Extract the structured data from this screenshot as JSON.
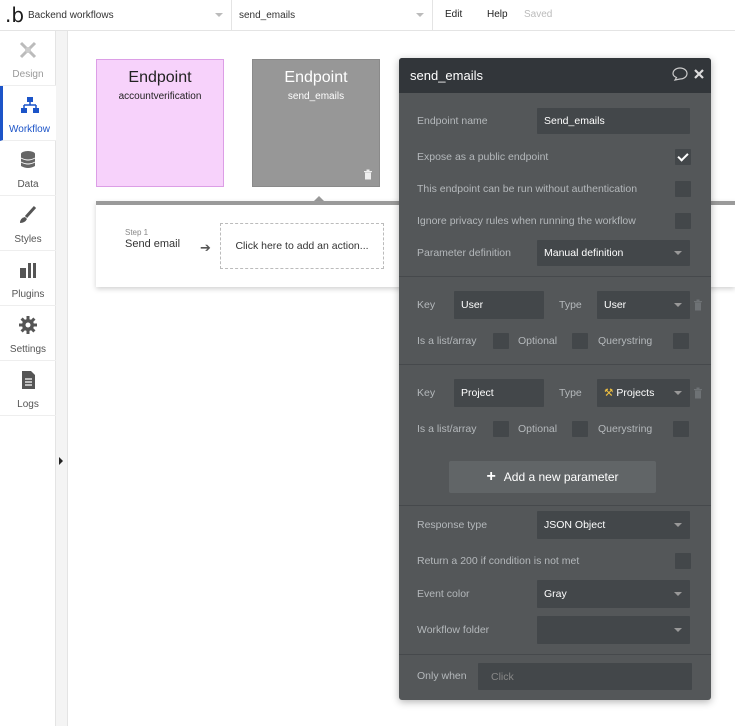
{
  "topbar": {
    "logo": ".b",
    "page_select": "Backend workflows",
    "workflow_select": "send_emails",
    "edit_label": "Edit",
    "help_label": "Help",
    "saved_label": "Saved"
  },
  "sidebar": {
    "items": [
      {
        "label": "Design",
        "icon": "design-icon"
      },
      {
        "label": "Workflow",
        "icon": "workflow-icon"
      },
      {
        "label": "Data",
        "icon": "database-icon"
      },
      {
        "label": "Styles",
        "icon": "brush-icon"
      },
      {
        "label": "Plugins",
        "icon": "plugins-icon"
      },
      {
        "label": "Settings",
        "icon": "gear-icon"
      },
      {
        "label": "Logs",
        "icon": "document-icon"
      }
    ],
    "active_accent": "#1c54c8"
  },
  "canvas": {
    "cards": [
      {
        "title": "Endpoint",
        "subtitle": "accountverification",
        "color": "#f7d2fb"
      },
      {
        "title": "Endpoint",
        "subtitle": "send_emails",
        "color": "#979797"
      }
    ],
    "step": {
      "step_label": "Step 1",
      "step_name": "Send email",
      "add_action": "Click here to add an action..."
    }
  },
  "panel": {
    "title": "send_emails",
    "endpoint_name_label": "Endpoint name",
    "endpoint_name_value": "Send_emails",
    "expose_label": "Expose as a public endpoint",
    "expose_checked": true,
    "no_auth_label": "This endpoint can be run without authentication",
    "ignore_privacy_label": "Ignore privacy rules when running the workflow",
    "param_def_label": "Parameter definition",
    "param_def_value": "Manual definition",
    "params": [
      {
        "key_label": "Key",
        "key_value": "User",
        "type_label": "Type",
        "type_value": "User",
        "list_label": "Is a list/array",
        "optional_label": "Optional",
        "querystring_label": "Querystring"
      },
      {
        "key_label": "Key",
        "key_value": "Project",
        "type_label": "Type",
        "type_value": "Projects",
        "type_icon": "⚒",
        "list_label": "Is a list/array",
        "optional_label": "Optional",
        "querystring_label": "Querystring"
      }
    ],
    "add_param_label": "Add a new parameter",
    "response_type_label": "Response type",
    "response_type_value": "JSON Object",
    "return200_label": "Return a 200 if condition is not met",
    "event_color_label": "Event color",
    "event_color_value": "Gray",
    "folder_label": "Workflow folder",
    "folder_value": "",
    "only_when_label": "Only when",
    "only_when_placeholder": "Click",
    "colors": {
      "panel_bg": "#545759",
      "header_bg": "#32363a",
      "input_bg": "#43474a"
    }
  }
}
